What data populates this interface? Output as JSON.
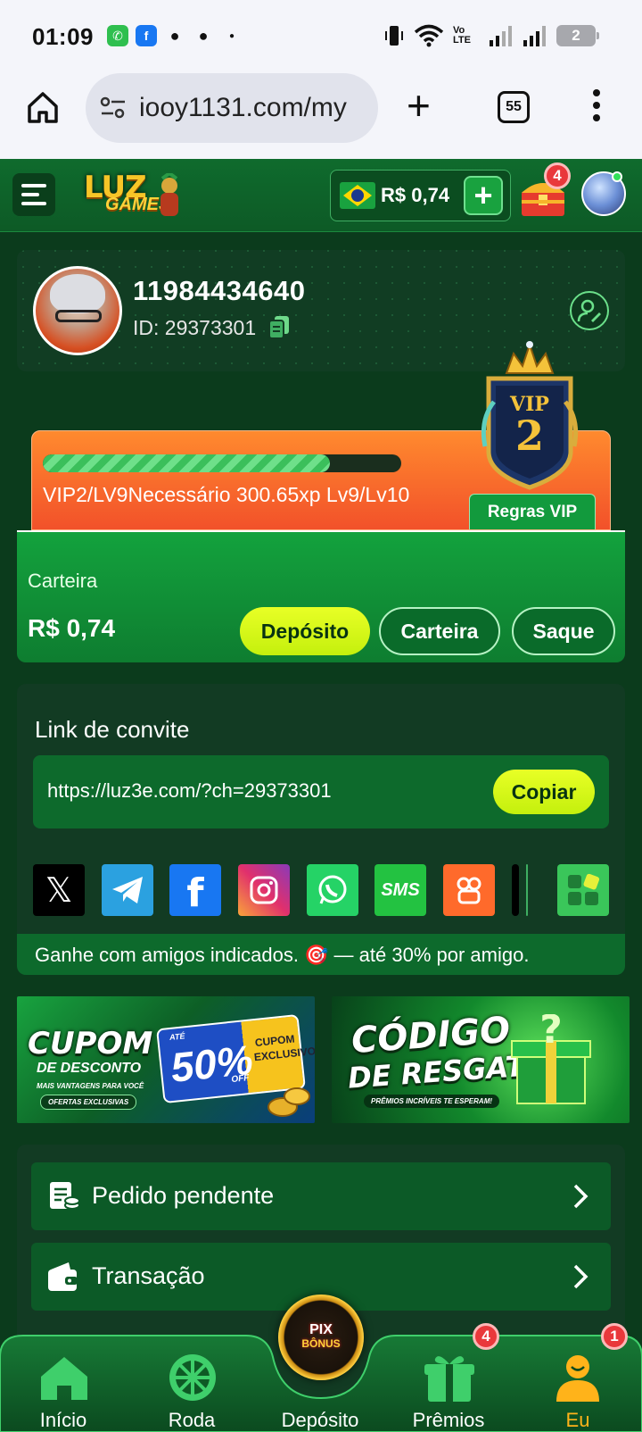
{
  "status_bar": {
    "time": "01:09",
    "battery": "2",
    "network": "Vo LTE"
  },
  "browser": {
    "url": "iooy1131.com/my",
    "tab_count": "55"
  },
  "header": {
    "logo_top": "LUZ",
    "logo_bottom": "GAMES",
    "balance": "R$ 0,74",
    "chest_badge": "4"
  },
  "profile": {
    "username": "11984434640",
    "id_label": "ID: 29373301"
  },
  "vip": {
    "level_badge_top": "VIP",
    "level_badge_num": "2",
    "progress": 0.8,
    "progress_text": "VIP2/LV9Necessário 300.65xp Lv9/Lv10",
    "rules_label": "Regras VIP"
  },
  "wallet": {
    "label": "Carteira",
    "amount": "R$ 0,74",
    "deposit_label": "Depósito",
    "wallet_label": "Carteira",
    "withdraw_label": "Saque"
  },
  "invite": {
    "title": "Link de convite",
    "link": "https://luz3e.com/?ch=29373301",
    "copy_label": "Copiar",
    "share_sms": "SMS",
    "footer_text": "Ganhe com amigos indicados. 🎯 — até 30% por amigo."
  },
  "banners": {
    "coupon_line1": "CUPOM",
    "coupon_line2": "DE DESCONTO",
    "coupon_small": "MAIS VANTAGENS PARA VOCÊ",
    "coupon_pill": "OFERTAS EXCLUSIVAS",
    "coupon_ate": "ATÉ",
    "coupon_pct": "50%",
    "coupon_off": "OFF",
    "coupon_side": "CUPOM EXCLUSIVO",
    "code_line1": "CÓDIGO",
    "code_line2": "DE RESGATE",
    "code_small": "PRÊMIOS INCRÍVEIS TE ESPERAM!"
  },
  "menu": {
    "items": [
      {
        "label": "Pedido pendente"
      },
      {
        "label": "Transação"
      }
    ]
  },
  "bottom_nav": {
    "home": "Início",
    "wheel": "Roda",
    "deposit": "Depósito",
    "prizes": "Prêmios",
    "prizes_badge": "4",
    "me": "Eu",
    "me_badge": "1",
    "pix_top": "PIX",
    "pix_bottom": "BÔNUS"
  },
  "colors": {
    "accent_yellow": "#d4f716",
    "brand_green": "#13a23d",
    "vip_orange": "#f2512a",
    "badge_red": "#e9383b"
  }
}
